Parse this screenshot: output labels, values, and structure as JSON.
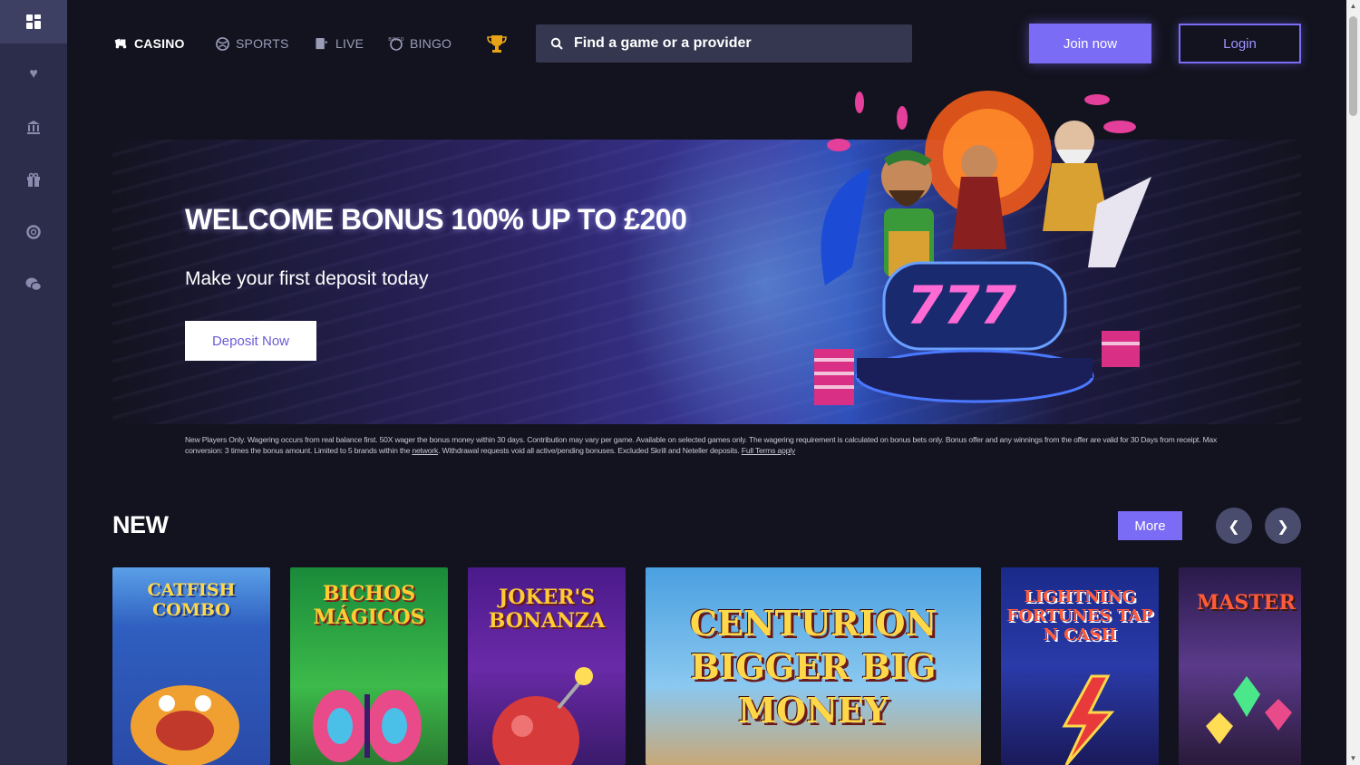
{
  "sidebar": {
    "items": [
      {
        "icon": "dashboard-icon",
        "glyph": "▦",
        "active": true
      },
      {
        "icon": "heart-icon",
        "glyph": "♥"
      },
      {
        "icon": "bank-icon",
        "glyph": "⌂"
      },
      {
        "icon": "gift-icon",
        "glyph": "✚"
      },
      {
        "icon": "lifebuoy-icon",
        "glyph": "◎"
      },
      {
        "icon": "chat-icon",
        "glyph": "✎"
      }
    ]
  },
  "nav": {
    "casino": "CASINO",
    "sports": "SPORTS",
    "live": "LIVE",
    "bingo": "BINGO"
  },
  "search": {
    "placeholder": "Find a game or a provider"
  },
  "auth": {
    "join": "Join now",
    "login": "Login"
  },
  "hero": {
    "title": "WELCOME BONUS 100% UP TO £200",
    "subtitle": "Make your first deposit today",
    "cta": "Deposit Now"
  },
  "terms": {
    "part1": "New Players Only. Wagering occurs from real balance first. 50X wager the bonus money within 30 days. Contribution may vary per game. Available on selected games only. The wagering requirement is calculated on bonus bets only. Bonus offer and any winnings from the offer are valid for 30 Days from receipt. Max conversion: 3 times the bonus amount. Limited to 5 brands within the ",
    "link1": "network",
    "part2": ". Withdrawal requests void all active/pending bonuses. Excluded Skrill and Neteller deposits. ",
    "link2": "Full Terms apply"
  },
  "new_section": {
    "title": "NEW",
    "more": "More",
    "games": [
      {
        "title": "CATFISH COMBO"
      },
      {
        "title": "BICHOS MÁGICOS"
      },
      {
        "title": "JOKER'S BONANZA"
      },
      {
        "title": "CENTURION BIGGER BIG MONEY"
      },
      {
        "title": "LIGHTNING FORTUNES TAP N CASH"
      },
      {
        "title": "MASTER GEMS"
      }
    ]
  },
  "colors": {
    "accent": "#7b6cf6",
    "background": "#13131f",
    "sidebar": "#2b2d4a"
  }
}
